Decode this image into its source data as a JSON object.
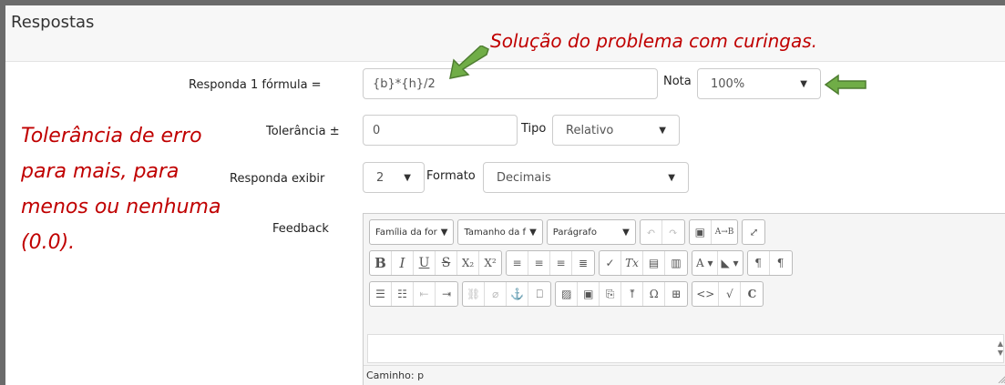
{
  "section": {
    "title": "Respostas"
  },
  "annotations": {
    "solution": "Solução do problema com curingas.",
    "tolerance_lines": [
      "Tolerância de erro",
      "para mais, para",
      "menos ou nenhuma",
      "(0.0)."
    ]
  },
  "colors": {
    "annotation": "#c00000",
    "arrow": "#70ad47",
    "arrow_outline": "#4e7d31"
  },
  "form": {
    "answer_label": "Responda 1 fórmula =",
    "answer_value": "{b}*{h}/2",
    "grade_label": "Nota",
    "grade_value": "100%",
    "tolerance_label": "Tolerância ±",
    "tolerance_value": "0",
    "type_label": "Tipo",
    "type_value": "Relativo",
    "display_label": "Responda exibir",
    "display_value": "2",
    "format_label": "Formato",
    "format_value": "Decimais",
    "feedback_label": "Feedback"
  },
  "editor": {
    "font_family": "Família da for",
    "font_size": "Tamanho da f",
    "paragraph": "Parágrafo",
    "path": "Caminho: p",
    "icons_row1": [
      "undo-icon",
      "redo-icon",
      "find-icon",
      "replace-icon",
      "fullscreen-icon"
    ],
    "icons_row2": [
      "bold-icon",
      "italic-icon",
      "underline-icon",
      "strikethrough-icon",
      "subscript-icon",
      "superscript-icon",
      "align-left-icon",
      "align-center-icon",
      "align-right-icon",
      "align-justify-icon",
      "clear-icon",
      "remove-format-icon",
      "paste-text-icon",
      "paste-word-icon",
      "text-color-icon",
      "background-color-icon",
      "ltr-icon",
      "rtl-icon"
    ],
    "icons_row3": [
      "bullet-list-icon",
      "numbered-list-icon",
      "outdent-icon",
      "indent-icon",
      "link-icon",
      "unlink-icon",
      "anchor-link-icon",
      "bookmark-icon",
      "image-icon",
      "media-icon",
      "manage-files-icon",
      "upload-icon",
      "special-char-icon",
      "table-icon",
      "html-icon",
      "equation-icon",
      "spellcheck-icon"
    ],
    "btn_bold": "B",
    "btn_italic": "I",
    "btn_underline": "U",
    "btn_strike": "S",
    "btn_sub": "X₂",
    "btn_sup": "X²",
    "btn_omega": "Ω",
    "btn_code": "<>",
    "btn_c": "C",
    "btn_tx": "Tx"
  }
}
